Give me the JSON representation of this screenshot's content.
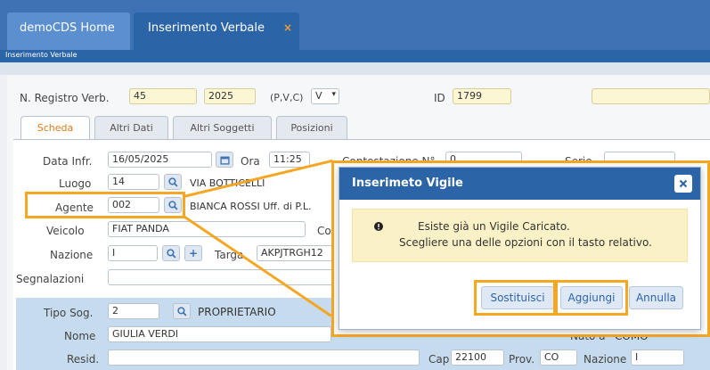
{
  "tabs": {
    "home": "demoCDS Home",
    "active": "Inserimento Verbale",
    "close": "×"
  },
  "breadcrumb": "Inserimento Verbale",
  "header": {
    "registro_label": "N. Registro Verb.",
    "registro_num": "45",
    "registro_anno": "2025",
    "pvc_label": "(P,V,C)",
    "pvc_value": "V",
    "id_label": "ID",
    "id_value": "1799"
  },
  "form_tabs": [
    "Scheda",
    "Altri Dati",
    "Altri Soggetti",
    "Posizioni"
  ],
  "scheda": {
    "data_label": "Data Infr.",
    "data_value": "16/05/2025",
    "ora_label": "Ora",
    "ora_value": "11:25",
    "contestazione_label": "Contestazione N°",
    "contestazione_value": "0",
    "serie_label": "Serie",
    "luogo_label": "Luogo",
    "luogo_code": "14",
    "luogo_desc": "VIA BOTTICELLI",
    "agente_label": "Agente",
    "agente_code": "002",
    "agente_desc": "BIANCA ROSSI  Uff. di P.L.",
    "veicolo_label": "Veicolo",
    "veicolo_value": "FIAT PANDA",
    "veicolo_side": "Co",
    "nazione_label": "Nazione",
    "nazione_value": "I",
    "targa_label": "Targa",
    "targa_value": "AKPJTRGH12",
    "segnalazioni_label": "Segnalazioni"
  },
  "soggetto": {
    "tipo_label": "Tipo Sog.",
    "tipo_code": "2",
    "tipo_desc": "PROPRIETARIO",
    "nome_label": "Nome",
    "nome_value": "GIULIA VERDI",
    "nato_label": "Nato a",
    "nato_value": "COMO",
    "resid_label": "Resid.",
    "cap_label": "Cap",
    "cap_value": "22100",
    "prov_label": "Prov.",
    "prov_value": "CO",
    "nazione_label": "Nazione",
    "nazione_value": "I"
  },
  "dialog": {
    "title": "Inserimeto Vigile",
    "line1": "Esiste già un Vigile Caricato.",
    "line2": "Scegliere una delle opzioni con il tasto relativo.",
    "buttons": {
      "sostituisci": "Sostituisci",
      "aggiungi": "Aggiungi",
      "annulla": "Annulla"
    }
  },
  "colors": {
    "accent": "#2c64a8",
    "highlight": "#f5a623",
    "active_tab": "#e07b1a",
    "warning_bg": "#fbf1c7"
  }
}
